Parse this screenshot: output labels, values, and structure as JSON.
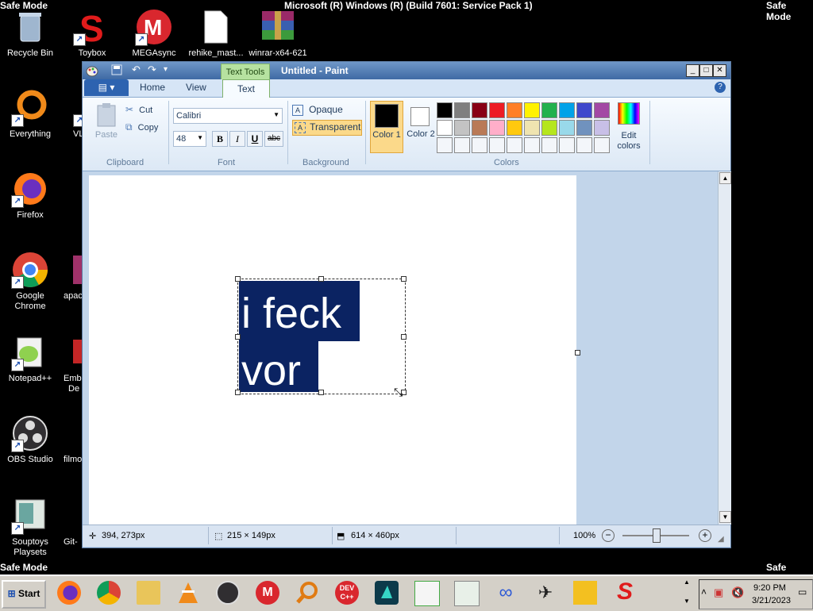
{
  "screen": {
    "safe_mode_label": "Safe Mode",
    "window_title_bar": "Microsoft (R) Windows (R) (Build 7601: Service Pack 1)"
  },
  "desktop_icons": [
    {
      "label": "Recycle Bin",
      "icon": "recycle-bin-icon"
    },
    {
      "label": "Toybox",
      "icon": "toybox-icon"
    },
    {
      "label": "MEGAsync",
      "icon": "megasync-icon"
    },
    {
      "label": "rehike_mast...",
      "icon": "file-icon"
    },
    {
      "label": "winrar-x64-621",
      "icon": "winrar-icon"
    },
    {
      "label": "Everything",
      "icon": "everything-icon"
    },
    {
      "label": "VL",
      "icon": "vlc-icon"
    },
    {
      "label": "Firefox",
      "icon": "firefox-icon"
    },
    {
      "label": "Google Chrome",
      "icon": "chrome-icon"
    },
    {
      "label": "apac",
      "icon": "apache-icon"
    },
    {
      "label": "Notepad++",
      "icon": "notepadpp-icon"
    },
    {
      "label": "Emb",
      "icon": "embarcadero-icon"
    },
    {
      "label": "De",
      "icon": "dev-icon"
    },
    {
      "label": "OBS Studio",
      "icon": "obs-icon"
    },
    {
      "label": "filmo",
      "icon": "filmora-icon"
    },
    {
      "label": "Souptoys Playsets",
      "icon": "souptoys-icon"
    },
    {
      "label": "Git-",
      "icon": "git-icon"
    }
  ],
  "paint": {
    "title": "Untitled - Paint",
    "contextual_tab": "Text Tools",
    "tabs": [
      "Home",
      "View",
      "Text"
    ],
    "clipboard": {
      "group": "Clipboard",
      "paste": "Paste",
      "cut": "Cut",
      "copy": "Copy"
    },
    "font": {
      "group": "Font",
      "family": "Calibri",
      "size": "48",
      "bold": "B",
      "italic": "I",
      "underline": "U",
      "strike": "abc"
    },
    "background": {
      "group": "Background",
      "opaque": "Opaque",
      "transparent": "Transparent"
    },
    "colors": {
      "group": "Colors",
      "color1": "Color 1",
      "color2": "Color 2",
      "edit": "Edit colors",
      "color1_value": "#000000",
      "color2_value": "#ffffff",
      "row1": [
        "#000000",
        "#7f7f7f",
        "#880015",
        "#ed1c24",
        "#ff7f27",
        "#fff200",
        "#22b14c",
        "#00a2e8",
        "#3f48cc",
        "#a349a4"
      ],
      "row2": [
        "#ffffff",
        "#c3c3c3",
        "#b97a57",
        "#ffaec9",
        "#ffc90e",
        "#efe4b0",
        "#b5e61d",
        "#99d9ea",
        "#7092be",
        "#c8bfe7"
      ]
    },
    "canvas_text": [
      "i feck",
      "vor"
    ],
    "text_highlight_color": "#0b2362",
    "status": {
      "cursor_pos": "394, 273px",
      "selection_size": "215 × 149px",
      "image_size": "614 × 460px",
      "zoom": "100%",
      "zoom_out": "−",
      "zoom_in": "+"
    }
  },
  "taskbar": {
    "start": "Start",
    "icons": [
      "firefox-icon",
      "chrome-icon",
      "explorer-icon",
      "vlc-icon",
      "obs-icon",
      "megasync-icon",
      "search-icon",
      "devcpp-icon",
      "filmora-icon",
      "notepad-icon",
      "paint-icon",
      "loop-icon",
      "tool-icon",
      "cookie-icon",
      "toybox-icon"
    ],
    "time": "9:20 PM",
    "date": "3/21/2023"
  }
}
